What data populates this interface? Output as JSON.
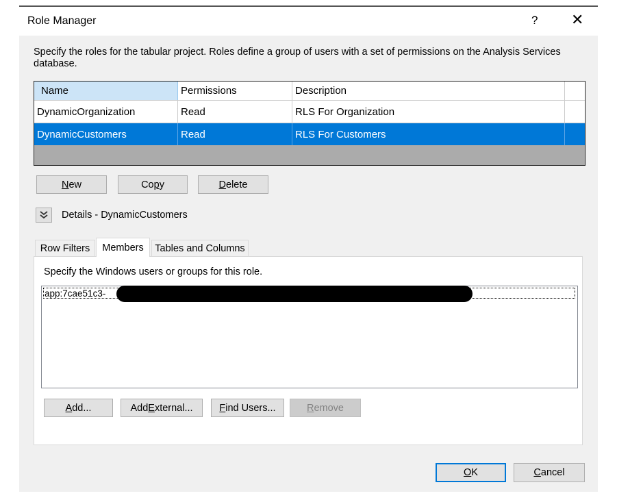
{
  "window": {
    "title": "Role Manager",
    "help_label": "?",
    "close_label": "✕"
  },
  "description": "Specify the roles for the tabular project. Roles define a group of users with a set of permissions on the Analysis Services database.",
  "grid": {
    "columns": [
      "Name",
      "Permissions",
      "Description"
    ],
    "rows": [
      {
        "name": "DynamicOrganization",
        "permissions": "Read",
        "description": "RLS For Organization"
      },
      {
        "name": "DynamicCustomers",
        "permissions": "Read",
        "description": "RLS For Customers"
      }
    ],
    "selected_index": 1
  },
  "role_buttons": {
    "new_first": "N",
    "new_rest": "ew",
    "copy_first": "Co",
    "copy_ul": "p",
    "copy_rest": "y",
    "delete_first": "D",
    "delete_rest": "elete"
  },
  "details": {
    "expander_icon": "chevron-double-down-icon",
    "label": "Details - DynamicCustomers"
  },
  "tabs": [
    "Row Filters",
    "Members",
    "Tables and Columns"
  ],
  "active_tab": "Members",
  "members": {
    "instruction": "Specify the Windows users or groups for this role.",
    "items": [
      "app:7cae51c3-"
    ]
  },
  "member_buttons": {
    "add_first": "A",
    "add_rest": "dd...",
    "add_external_a": "Add ",
    "add_external_ul": "E",
    "add_external_b": "xternal...",
    "find_users_first": "F",
    "find_users_rest": "ind Users...",
    "remove_first": "R",
    "remove_rest": "emove"
  },
  "footer": {
    "ok_ul": "O",
    "ok_rest": "K",
    "cancel_ul": "C",
    "cancel_rest": "ancel"
  },
  "colors": {
    "selection": "#0078d7",
    "dialog_bg": "#f0f0f0"
  }
}
